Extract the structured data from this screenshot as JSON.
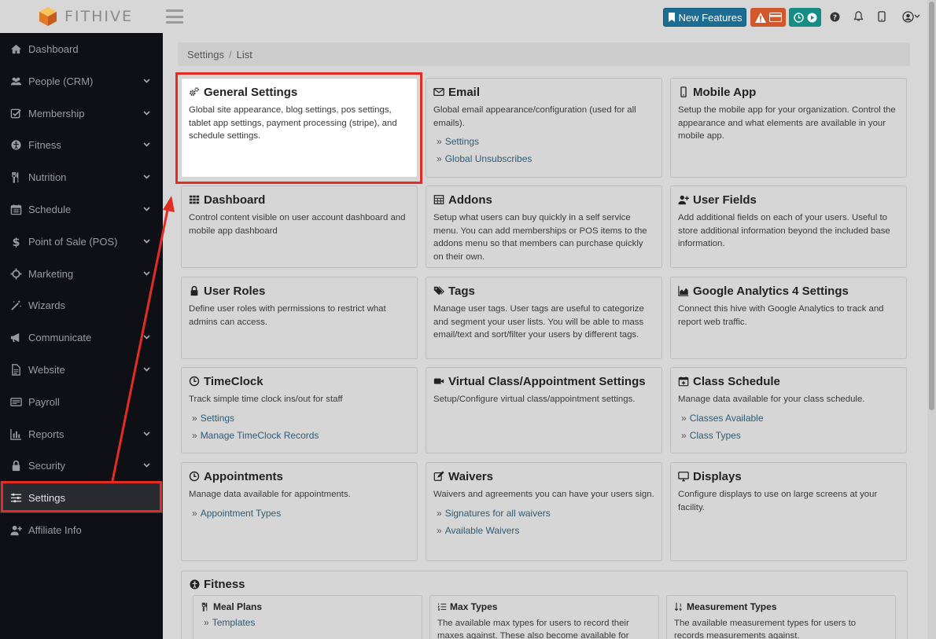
{
  "app": {
    "brand": "FITHIVE"
  },
  "topbar": {
    "new_features_label": "New Features",
    "icons": [
      "bookmark-icon",
      "warning-icon",
      "card-icon",
      "clock-icon",
      "play-icon",
      "help-icon",
      "bell-icon",
      "tablet-icon",
      "user-circle-icon"
    ]
  },
  "colors": {
    "sidebar_bg": "#0f1016",
    "highlight": "#e42d22",
    "new_features": "#1c6d92",
    "alert": "#d3572c",
    "clock": "#168d84",
    "link": "#2f5b75"
  },
  "sidebar": {
    "items": [
      {
        "label": "Dashboard",
        "icon": "home-icon",
        "chevron": false
      },
      {
        "label": "People (CRM)",
        "icon": "users-icon",
        "chevron": true
      },
      {
        "label": "Membership",
        "icon": "check-square-icon",
        "chevron": true
      },
      {
        "label": "Fitness",
        "icon": "person-circle-icon",
        "chevron": true
      },
      {
        "label": "Nutrition",
        "icon": "utensils-icon",
        "chevron": true
      },
      {
        "label": "Schedule",
        "icon": "calendar-icon",
        "chevron": true
      },
      {
        "label": "Point of Sale (POS)",
        "icon": "dollar-icon",
        "chevron": true
      },
      {
        "label": "Marketing",
        "icon": "crosshair-icon",
        "chevron": true
      },
      {
        "label": "Wizards",
        "icon": "magic-wand-icon",
        "chevron": false
      },
      {
        "label": "Communicate",
        "icon": "bullhorn-icon",
        "chevron": true
      },
      {
        "label": "Website",
        "icon": "file-icon",
        "chevron": true
      },
      {
        "label": "Payroll",
        "icon": "money-icon",
        "chevron": false
      },
      {
        "label": "Reports",
        "icon": "bar-chart-icon",
        "chevron": true
      },
      {
        "label": "Security",
        "icon": "lock-icon",
        "chevron": true
      },
      {
        "label": "Settings",
        "icon": "sliders-icon",
        "chevron": false,
        "active": true
      },
      {
        "label": "Affiliate Info",
        "icon": "user-plus-icon",
        "chevron": false
      }
    ]
  },
  "breadcrumb": {
    "root": "Settings",
    "separator": "/",
    "current": "List"
  },
  "cards": [
    {
      "title": "General Settings",
      "icon": "gears-icon",
      "desc": "Global site appearance, blog settings, pos settings, tablet app settings, payment processing (stripe), and schedule settings.",
      "links": []
    },
    {
      "title": "Email",
      "icon": "envelope-icon",
      "desc": "Global email appearance/configuration (used for all emails).",
      "links": [
        "Settings",
        "Global Unsubscribes"
      ]
    },
    {
      "title": "Mobile App",
      "icon": "mobile-icon",
      "desc": "Setup the mobile app for your organization. Control the appearance and what elements are available in your mobile app.",
      "links": []
    },
    {
      "title": "Dashboard",
      "icon": "grid-icon",
      "desc": "Control content visible on user account dashboard and mobile app dashboard",
      "links": []
    },
    {
      "title": "Addons",
      "icon": "table-icon",
      "desc": "Setup what users can buy quickly in a self service menu. You can add memberships or POS items to the addons menu so that members can purchase quickly on their own.",
      "links": []
    },
    {
      "title": "User Fields",
      "icon": "user-plus-icon",
      "desc": "Add additional fields on each of your users. Useful to store additional information beyond the included base information.",
      "links": []
    },
    {
      "title": "User Roles",
      "icon": "lock-icon",
      "desc": "Define user roles with permissions to restrict what admins can access.",
      "links": []
    },
    {
      "title": "Tags",
      "icon": "tags-icon",
      "desc": "Manage user tags. User tags are useful to categorize and segment your user lists. You will be able to mass email/text and sort/filter your users by different tags.",
      "links": []
    },
    {
      "title": "Google Analytics 4 Settings",
      "icon": "area-chart-icon",
      "desc": "Connect this hive with Google Analytics to track and report web traffic.",
      "links": []
    },
    {
      "title": "TimeClock",
      "icon": "clock-icon",
      "desc": "Track simple time clock ins/out for staff",
      "links": [
        "Settings",
        "Manage TimeClock Records"
      ]
    },
    {
      "title": "Virtual Class/Appointment Settings",
      "icon": "video-icon",
      "desc": "Setup/Configure virtual class/appointment settings.",
      "links": []
    },
    {
      "title": "Class Schedule",
      "icon": "calendar-plus-icon",
      "desc": "Manage data available for your class schedule.",
      "links": [
        "Classes Available",
        "Class Types"
      ]
    },
    {
      "title": "Appointments",
      "icon": "clock-icon",
      "desc": "Manage data available for appointments.",
      "links": [
        "Appointment Types"
      ]
    },
    {
      "title": "Waivers",
      "icon": "edit-icon",
      "desc": "Waivers and agreements you can have your users sign.",
      "links": [
        "Signatures for all waivers",
        "Available Waivers"
      ]
    },
    {
      "title": "Displays",
      "icon": "monitor-icon",
      "desc": "Configure displays to use on large screens at your facility.",
      "links": []
    }
  ],
  "fitness": {
    "title": "Fitness",
    "subs": [
      {
        "title": "Meal Plans",
        "icon": "utensils-icon",
        "desc": "",
        "link": "Templates"
      },
      {
        "title": "Max Types",
        "icon": "list-ordered-icon",
        "desc": "The available max types for users to record their maxes against. These also become available for",
        "link": ""
      },
      {
        "title": "Measurement Types",
        "icon": "sort-numeric-icon",
        "desc": "The available measurement types for users to records measurements against.",
        "link": ""
      }
    ]
  }
}
